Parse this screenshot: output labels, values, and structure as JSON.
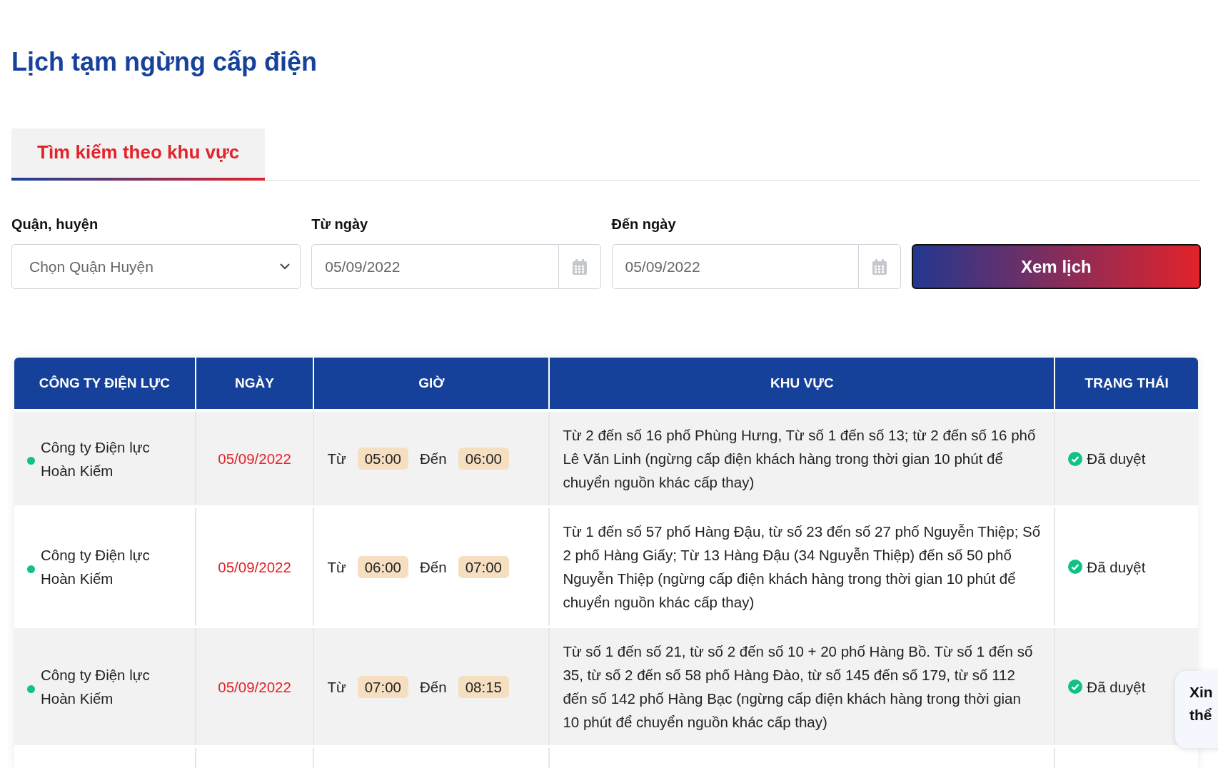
{
  "title": "Lịch tạm ngừng cấp điện",
  "tabs": [
    {
      "label": "Tìm kiếm theo khu vực",
      "selected": true
    }
  ],
  "filters": [
    {
      "kind": "select",
      "label": "Quận, huyện",
      "placeholder": "Chọn Quận Huyện"
    },
    {
      "kind": "date",
      "label": "Từ ngày",
      "value": "05/09/2022"
    },
    {
      "kind": "date",
      "label": "Đến ngày",
      "value": "05/09/2022"
    }
  ],
  "search_button": "Xem lịch",
  "table": {
    "columns": [
      "CÔNG TY ĐIỆN LỰC",
      "NGÀY",
      "GIỜ",
      "KHU VỰC",
      "TRẠNG THÁI"
    ],
    "rows": [
      {
        "company": "Công ty Điện lực Hoàn Kiếm",
        "date": "05/09/2022",
        "from_label": "Từ",
        "from": "05:00",
        "to_label": "Đến",
        "to": "06:00",
        "area": "Từ 2 đến số 16 phố Phùng Hưng, Từ số 1 đến số 13; từ 2 đến số 16 phố Lê Văn Linh (ngừng cấp điện khách hàng trong thời gian 10 phút để chuyển nguồn khác cấp thay)",
        "status": "Đã duyệt"
      },
      {
        "company": "Công ty Điện lực Hoàn Kiếm",
        "date": "05/09/2022",
        "from_label": "Từ",
        "from": "06:00",
        "to_label": "Đến",
        "to": "07:00",
        "area": "Từ 1 đến số 57 phố Hàng Đậu, từ số 23 đến số 27 phố Nguyễn Thiệp; Số 2 phố Hàng Giấy; Từ 13 Hàng Đậu (34 Nguyễn Thiệp) đến số 50 phố Nguyễn Thiệp (ngừng cấp điện khách hàng trong thời gian 10 phút để chuyển nguồn khác cấp thay)",
        "status": "Đã duyệt"
      },
      {
        "company": "Công ty Điện lực Hoàn Kiếm",
        "date": "05/09/2022",
        "from_label": "Từ",
        "from": "07:00",
        "to_label": "Đến",
        "to": "08:15",
        "area": "Từ số 1 đến số 21, từ số 2 đến số 10 + 20 phố Hàng Bồ. Từ số 1 đến số 35, từ số 2 đến số 58 phố Hàng Đào, từ số 145 đến số 179, từ số 112 đến số 142 phố Hàng Bạc (ngừng cấp điện khách hàng trong thời gian 10 phút để chuyển nguồn khác cấp thay)",
        "status": "Đã duyệt"
      }
    ]
  },
  "chat_bubble": {
    "lines": [
      "Xin",
      "thể"
    ]
  }
}
